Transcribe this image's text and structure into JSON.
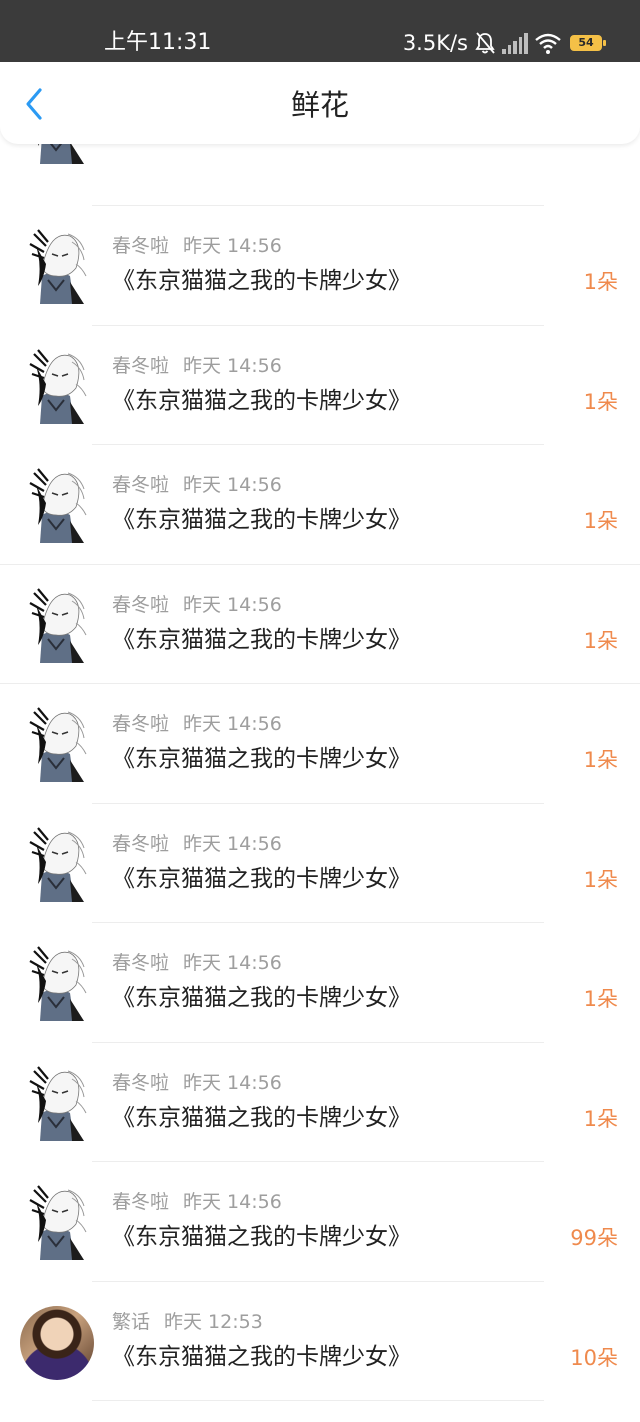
{
  "status_bar": {
    "time": "上午11:31",
    "network_speed": "3.5K/s",
    "battery": "54",
    "icons": [
      "bell-off-icon",
      "signal-icon",
      "wifi-icon",
      "battery-icon"
    ]
  },
  "header": {
    "back_icon": "chevron-left-icon",
    "title": "鲜花"
  },
  "colors": {
    "accent_blue": "#2b9af3",
    "count_orange": "#ef8a4d",
    "meta_gray": "#9e9e9e",
    "status_bar_bg": "#3b3b3b"
  },
  "list": [
    {
      "user": "",
      "time": "",
      "book": "《东京猫猫之我的卡牌少女》",
      "count": "1朵",
      "avatar": "sketch"
    },
    {
      "user": "春冬啦",
      "time": "昨天 14:56",
      "book": "《东京猫猫之我的卡牌少女》",
      "count": "1朵",
      "avatar": "sketch"
    },
    {
      "user": "春冬啦",
      "time": "昨天 14:56",
      "book": "《东京猫猫之我的卡牌少女》",
      "count": "1朵",
      "avatar": "sketch"
    },
    {
      "user": "春冬啦",
      "time": "昨天 14:56",
      "book": "《东京猫猫之我的卡牌少女》",
      "count": "1朵",
      "avatar": "sketch"
    },
    {
      "user": "春冬啦",
      "time": "昨天 14:56",
      "book": "《东京猫猫之我的卡牌少女》",
      "count": "1朵",
      "avatar": "sketch"
    },
    {
      "user": "春冬啦",
      "time": "昨天 14:56",
      "book": "《东京猫猫之我的卡牌少女》",
      "count": "1朵",
      "avatar": "sketch"
    },
    {
      "user": "春冬啦",
      "time": "昨天 14:56",
      "book": "《东京猫猫之我的卡牌少女》",
      "count": "1朵",
      "avatar": "sketch"
    },
    {
      "user": "春冬啦",
      "time": "昨天 14:56",
      "book": "《东京猫猫之我的卡牌少女》",
      "count": "1朵",
      "avatar": "sketch"
    },
    {
      "user": "春冬啦",
      "time": "昨天 14:56",
      "book": "《东京猫猫之我的卡牌少女》",
      "count": "1朵",
      "avatar": "sketch"
    },
    {
      "user": "春冬啦",
      "time": "昨天 14:56",
      "book": "《东京猫猫之我的卡牌少女》",
      "count": "99朵",
      "avatar": "sketch"
    },
    {
      "user": "繁话",
      "time": "昨天 12:53",
      "book": "《东京猫猫之我的卡牌少女》",
      "count": "10朵",
      "avatar": "photo"
    }
  ]
}
